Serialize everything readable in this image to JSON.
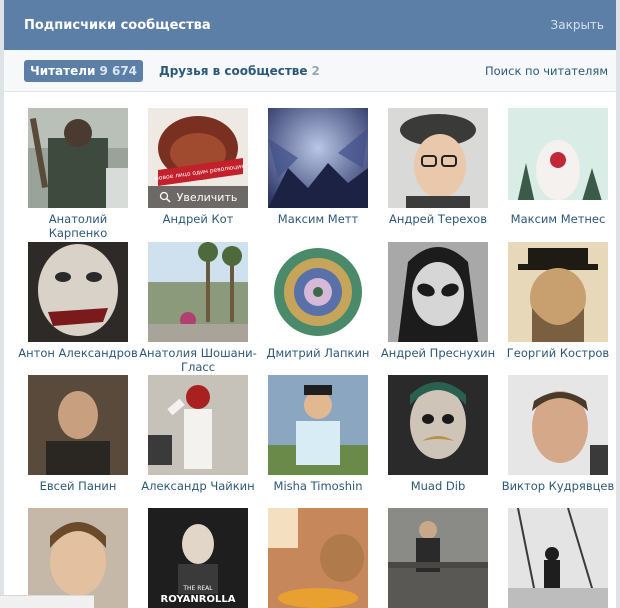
{
  "header": {
    "title": "Подписчики сообщества",
    "close_label": "Закрыть"
  },
  "tabs": {
    "readers_label": "Читатели",
    "readers_count": "9 674",
    "friends_label": "Друзья в сообществе",
    "friends_count": "2",
    "search_label": "Поиск по читателям"
  },
  "zoom_label": "Увеличить",
  "photo_caption": "новое лицо один революция",
  "poster_text": {
    "top": "THE REAL",
    "bottom": "ROYANROLLA"
  },
  "members": [
    {
      "name": "Анатолий Карпенко"
    },
    {
      "name": "Андрей Кот"
    },
    {
      "name": "Максим Метт"
    },
    {
      "name": "Андрей Терехов"
    },
    {
      "name": "Максим Метнес"
    },
    {
      "name": "Антон Александров"
    },
    {
      "name": "Анатолия Шошани-Гласс"
    },
    {
      "name": "Дмитрий Лапкин"
    },
    {
      "name": "Андрей Преснухин"
    },
    {
      "name": "Георгий Костров"
    },
    {
      "name": "Евсей Панин"
    },
    {
      "name": "Александр Чайкин"
    },
    {
      "name": "Misha Timoshin"
    },
    {
      "name": "Muad Dib"
    },
    {
      "name": "Виктор Кудрявцев"
    },
    {
      "name": ""
    },
    {
      "name": ""
    },
    {
      "name": ""
    },
    {
      "name": ""
    },
    {
      "name": ""
    }
  ]
}
